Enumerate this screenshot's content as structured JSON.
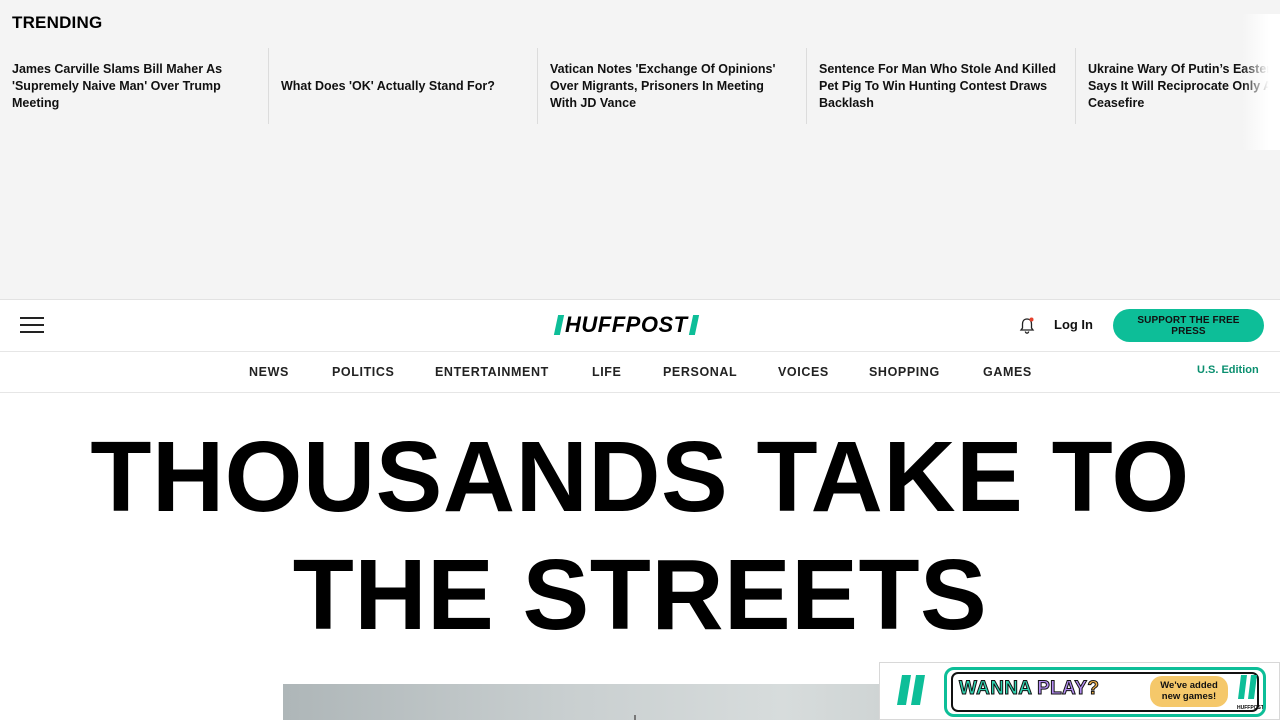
{
  "trending": {
    "title": "TRENDING",
    "items": [
      "James Carville Slams Bill Maher As 'Supremely Naive Man' Over Trump Meeting",
      "What Does 'OK' Actually Stand For?",
      "Vatican Notes 'Exchange Of Opinions' Over Migrants, Prisoners In Meeting With JD Vance",
      "Sentence For Man Who Stole And Killed Pet Pig To Win Hunting Contest Draws Backlash",
      "Ukraine Wary Of Putin’s Easter Truce, Says It Will Reciprocate Only A Genuine Ceasefire"
    ]
  },
  "header": {
    "logo_text": "HUFFPOST",
    "menu_icon": "hamburger-menu-icon",
    "bell_icon": "bell-icon",
    "login_label": "Log In",
    "support_label": "SUPPORT THE FREE PRESS"
  },
  "nav": {
    "items": [
      "NEWS",
      "POLITICS",
      "ENTERTAINMENT",
      "LIFE",
      "PERSONAL",
      "VOICES",
      "SHOPPING",
      "GAMES"
    ],
    "edition": "U.S. Edition"
  },
  "article": {
    "headline": "THOUSANDS TAKE TO THE STREETS"
  },
  "games_promo": {
    "wanna": "WANNA",
    "play": "PLAY",
    "question": "?",
    "badge": "We've added new games!",
    "mini_logo_text": "HUFFPOST"
  },
  "colors": {
    "brand": "#0dbe98",
    "edition_text": "#0a8f6f"
  }
}
